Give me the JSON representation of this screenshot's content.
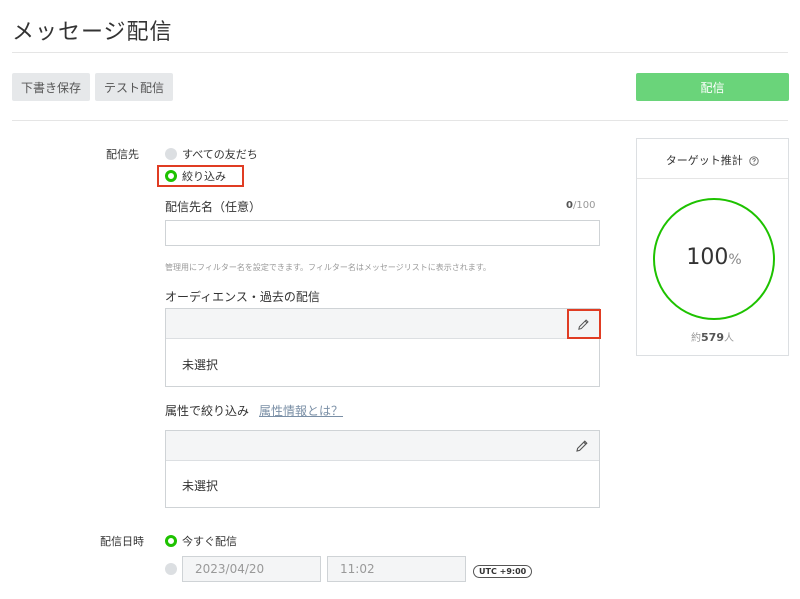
{
  "header": {
    "title": "メッセージ配信"
  },
  "toolbar": {
    "save_draft_label": "下書き保存",
    "test_send_label": "テスト配信",
    "send_label": "配信"
  },
  "recipients": {
    "label": "配信先",
    "options": [
      {
        "label": "すべての友だち",
        "selected": false
      },
      {
        "label": "絞り込み",
        "selected": true
      }
    ],
    "name_field": {
      "label": "配信先名（任意）",
      "counter_current": "0",
      "counter_max": "/100",
      "value": "",
      "placeholder": "",
      "help": "管理用にフィルター名を設定できます。フィルター名はメッセージリストに表示されます。"
    },
    "audience": {
      "label": "オーディエンス・過去の配信",
      "value": "未選択"
    },
    "attributes": {
      "label": "属性で絞り込み",
      "link": "属性情報とは？",
      "value": "未選択"
    }
  },
  "schedule": {
    "label": "配信日時",
    "options": [
      {
        "label": "今すぐ配信",
        "selected": true
      }
    ],
    "date": "2023/04/20",
    "time": "11:02",
    "timezone": "UTC +9:00"
  },
  "target": {
    "title": "ターゲット推計",
    "percent": "100",
    "percent_unit": "%",
    "approx_prefix": "約",
    "approx_count": "579",
    "approx_unit": "人"
  },
  "colors": {
    "accent_green": "#1ec200",
    "send_button": "#6ad47a",
    "highlight_red": "#e03c23"
  }
}
